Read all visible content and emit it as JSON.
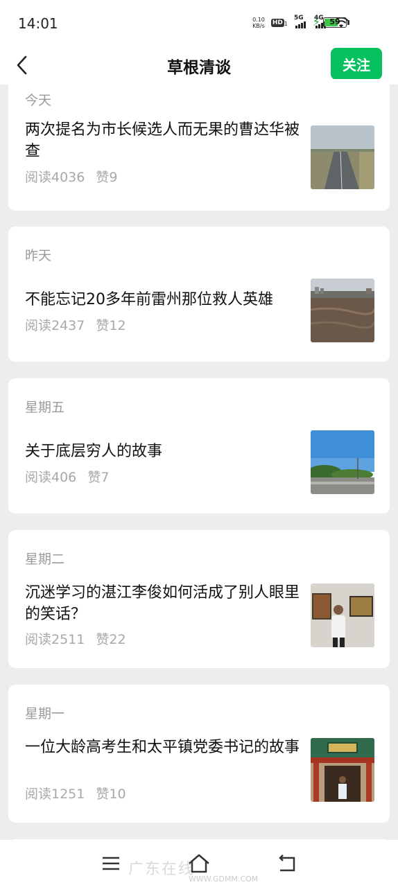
{
  "status_bar": {
    "time": "14:01",
    "net_speed_value": "0.10",
    "net_speed_unit": "KB/s",
    "hd_badge": "HD",
    "hd_sub": "1",
    "sig1_label": "5G",
    "sig2_label": "4G",
    "battery_level": "59"
  },
  "nav": {
    "title": "草根清谈",
    "follow_label": "关注"
  },
  "articles": [
    {
      "day": "今天",
      "title": "两次提名为市长候选人而无果的曹达华被查",
      "reads": "阅读4036",
      "likes": "赞9"
    },
    {
      "day": "昨天",
      "title": "不能忘记20多年前雷州那位救人英雄",
      "reads": "阅读2437",
      "likes": "赞12"
    },
    {
      "day": "星期五",
      "title": "关于底层穷人的故事",
      "reads": "阅读406",
      "likes": "赞7"
    },
    {
      "day": "星期二",
      "title": "沉迷学习的湛江李俊如何活成了别人眼里的笑话？",
      "reads": "阅读2511",
      "likes": "赞22"
    },
    {
      "day": "星期一",
      "title": "一位大龄高考生和太平镇党委书记的故事",
      "reads": "阅读1251",
      "likes": "赞10"
    }
  ],
  "watermark": {
    "text": "广东在线",
    "url": "WWW.GDMM.COM"
  }
}
